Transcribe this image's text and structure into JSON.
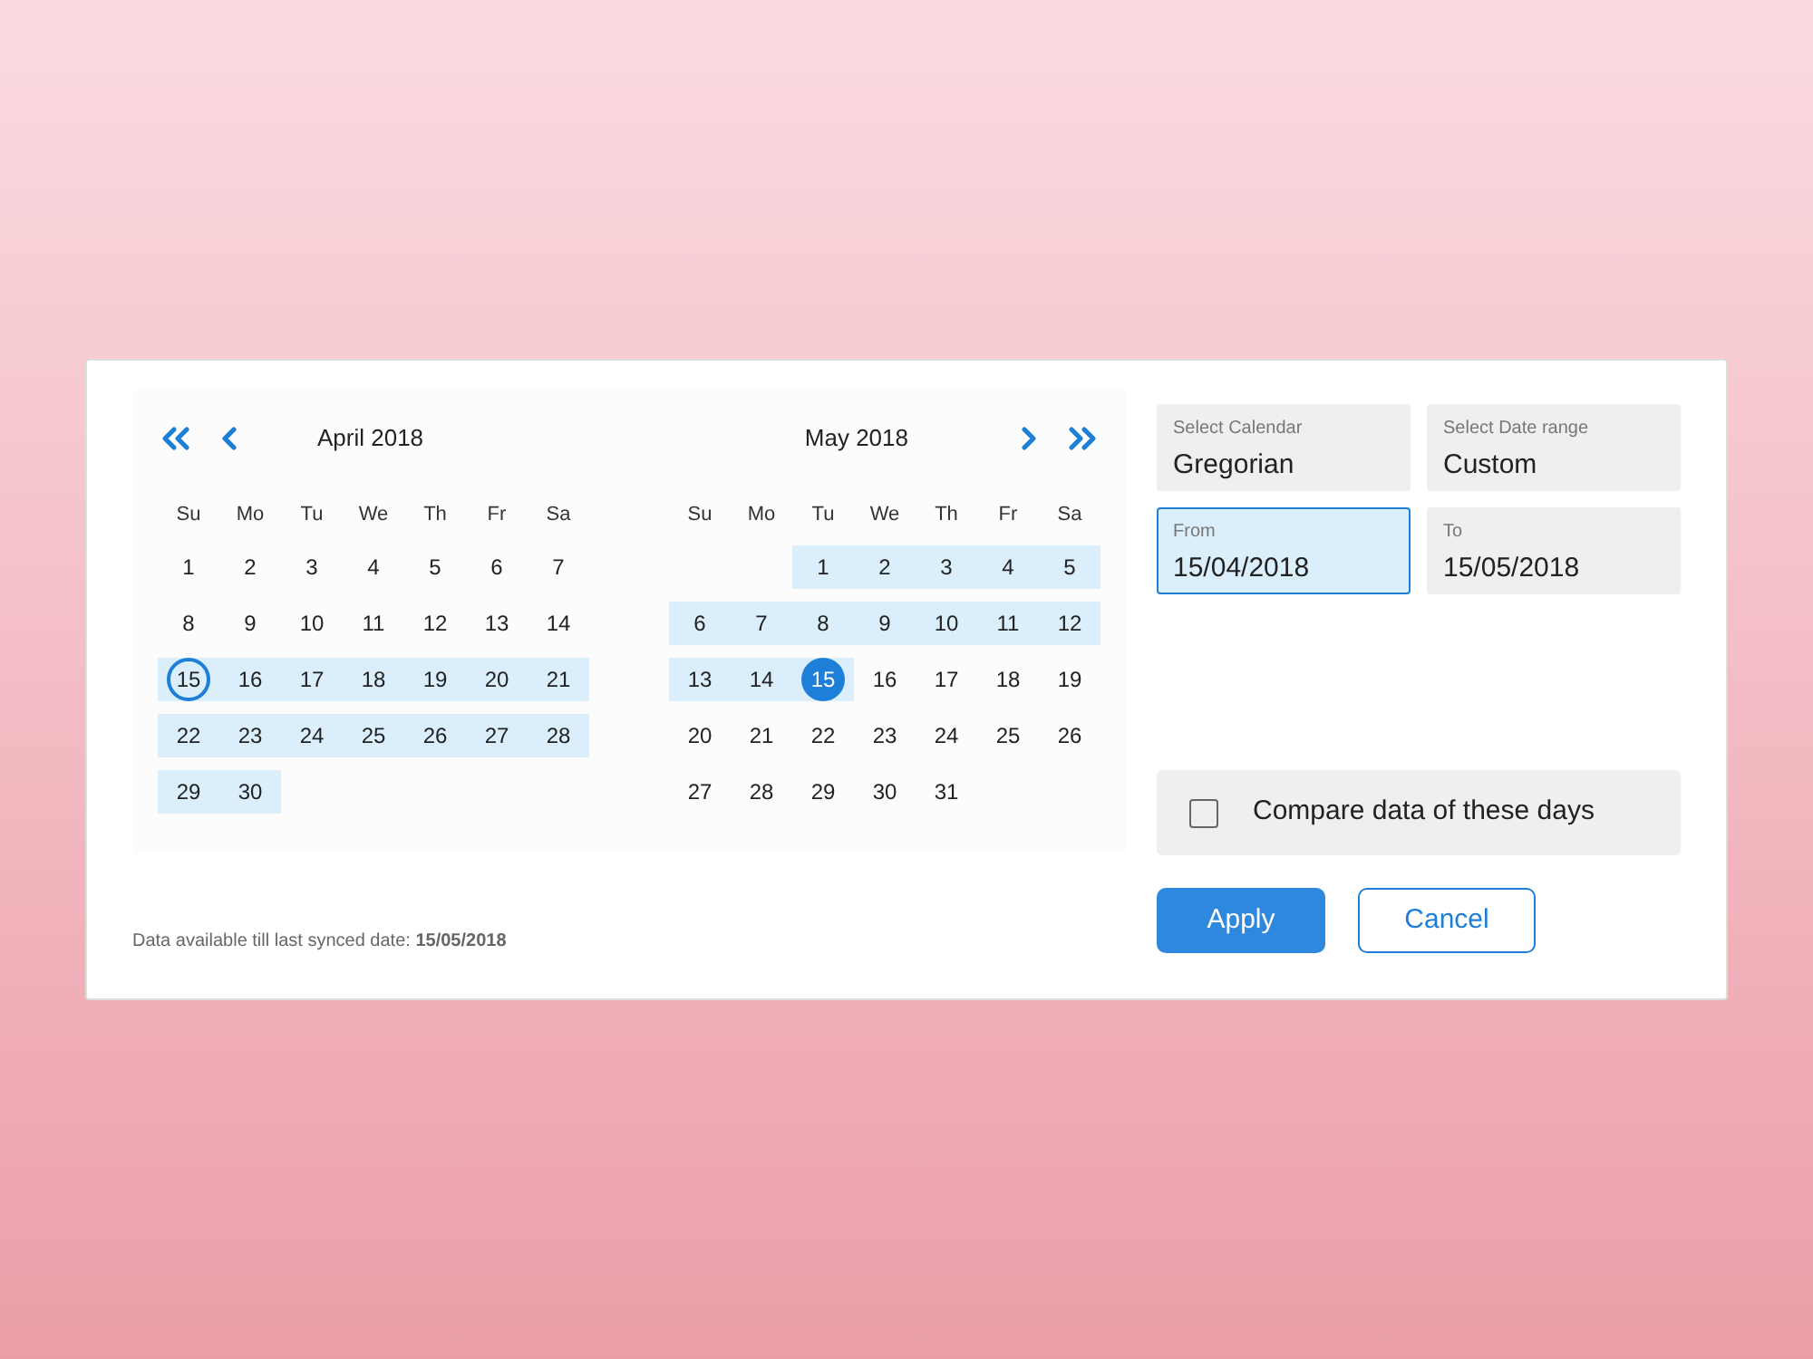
{
  "calendars": [
    {
      "title": "April 2018",
      "show_previous": true,
      "show_next": false,
      "weekdays": [
        "Su",
        "Mo",
        "Tu",
        "We",
        "Th",
        "Fr",
        "Sa"
      ],
      "weeks": [
        [
          {
            "kind": "day",
            "day": "1",
            "in_range": false
          },
          {
            "kind": "day",
            "day": "2",
            "in_range": false
          },
          {
            "kind": "day",
            "day": "3",
            "in_range": false
          },
          {
            "kind": "day",
            "day": "4",
            "in_range": false
          },
          {
            "kind": "day",
            "day": "5",
            "in_range": false
          },
          {
            "kind": "day",
            "day": "6",
            "in_range": false
          },
          {
            "kind": "day",
            "day": "7",
            "in_range": false
          }
        ],
        [
          {
            "kind": "day",
            "day": "8",
            "in_range": false
          },
          {
            "kind": "day",
            "day": "9",
            "in_range": false
          },
          {
            "kind": "day",
            "day": "10",
            "in_range": false
          },
          {
            "kind": "day",
            "day": "11",
            "in_range": false
          },
          {
            "kind": "day",
            "day": "12",
            "in_range": false
          },
          {
            "kind": "day",
            "day": "13",
            "in_range": false
          },
          {
            "kind": "day",
            "day": "14",
            "in_range": false
          }
        ],
        [
          {
            "kind": "day",
            "day": "15",
            "in_range": true,
            "range_start": true
          },
          {
            "kind": "day",
            "day": "16",
            "in_range": true
          },
          {
            "kind": "day",
            "day": "17",
            "in_range": true
          },
          {
            "kind": "day",
            "day": "18",
            "in_range": true
          },
          {
            "kind": "day",
            "day": "19",
            "in_range": true
          },
          {
            "kind": "day",
            "day": "20",
            "in_range": true
          },
          {
            "kind": "day",
            "day": "21",
            "in_range": true
          }
        ],
        [
          {
            "kind": "day",
            "day": "22",
            "in_range": true
          },
          {
            "kind": "day",
            "day": "23",
            "in_range": true
          },
          {
            "kind": "day",
            "day": "24",
            "in_range": true
          },
          {
            "kind": "day",
            "day": "25",
            "in_range": true
          },
          {
            "kind": "day",
            "day": "26",
            "in_range": true
          },
          {
            "kind": "day",
            "day": "27",
            "in_range": true
          },
          {
            "kind": "day",
            "day": "28",
            "in_range": true
          }
        ],
        [
          {
            "kind": "day",
            "day": "29",
            "in_range": true
          },
          {
            "kind": "day",
            "day": "30",
            "in_range": true
          }
        ]
      ]
    },
    {
      "title": "May 2018",
      "show_previous": false,
      "show_next": true,
      "weekdays": [
        "Su",
        "Mo",
        "Tu",
        "We",
        "Th",
        "Fr",
        "Sa"
      ],
      "weeks": [
        [
          {
            "kind": "blank"
          },
          {
            "kind": "blank"
          },
          {
            "kind": "day",
            "day": "1",
            "in_range": true
          },
          {
            "kind": "day",
            "day": "2",
            "in_range": true
          },
          {
            "kind": "day",
            "day": "3",
            "in_range": true
          },
          {
            "kind": "day",
            "day": "4",
            "in_range": true
          },
          {
            "kind": "day",
            "day": "5",
            "in_range": true
          }
        ],
        [
          {
            "kind": "day",
            "day": "6",
            "in_range": true
          },
          {
            "kind": "day",
            "day": "7",
            "in_range": true
          },
          {
            "kind": "day",
            "day": "8",
            "in_range": true
          },
          {
            "kind": "day",
            "day": "9",
            "in_range": true
          },
          {
            "kind": "day",
            "day": "10",
            "in_range": true
          },
          {
            "kind": "day",
            "day": "11",
            "in_range": true
          },
          {
            "kind": "day",
            "day": "12",
            "in_range": true
          }
        ],
        [
          {
            "kind": "day",
            "day": "13",
            "in_range": true
          },
          {
            "kind": "day",
            "day": "14",
            "in_range": true
          },
          {
            "kind": "day",
            "day": "15",
            "in_range": true,
            "range_end": true
          },
          {
            "kind": "day",
            "day": "16",
            "in_range": false
          },
          {
            "kind": "day",
            "day": "17",
            "in_range": false
          },
          {
            "kind": "day",
            "day": "18",
            "in_range": false
          },
          {
            "kind": "day",
            "day": "19",
            "in_range": false
          }
        ],
        [
          {
            "kind": "day",
            "day": "20",
            "in_range": false
          },
          {
            "kind": "day",
            "day": "21",
            "in_range": false
          },
          {
            "kind": "day",
            "day": "22",
            "in_range": false
          },
          {
            "kind": "day",
            "day": "23",
            "in_range": false
          },
          {
            "kind": "day",
            "day": "24",
            "in_range": false
          },
          {
            "kind": "day",
            "day": "25",
            "in_range": false
          },
          {
            "kind": "day",
            "day": "26",
            "in_range": false
          }
        ],
        [
          {
            "kind": "day",
            "day": "27",
            "in_range": false
          },
          {
            "kind": "day",
            "day": "28",
            "in_range": false
          },
          {
            "kind": "day",
            "day": "29",
            "in_range": false
          },
          {
            "kind": "day",
            "day": "30",
            "in_range": false
          },
          {
            "kind": "day",
            "day": "31",
            "in_range": false
          }
        ]
      ]
    }
  ],
  "note": "Data available till last synced date: **15/05/2018**",
  "fields": [
    {
      "label": "Select Calendar",
      "value": "Gregorian",
      "focused": false
    },
    {
      "label": "Select Date range",
      "value": "Custom",
      "focused": false
    },
    {
      "label": "From",
      "value": "15/04/2018",
      "focused": true
    },
    {
      "label": "To",
      "value": "15/05/2018",
      "focused": false
    }
  ],
  "compare": {
    "label": "Compare data of these days",
    "checked": false
  },
  "buttons": [
    {
      "label": "Apply",
      "kind": "primary"
    },
    {
      "label": "Cancel",
      "kind": "secondary"
    }
  ]
}
